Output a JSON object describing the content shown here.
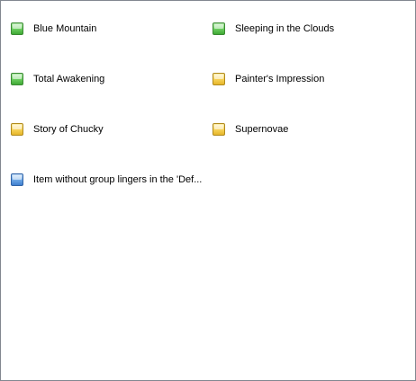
{
  "items": [
    {
      "label": "Blue Mountain",
      "icon": "green-square-icon",
      "color": "green"
    },
    {
      "label": "Sleeping in the Clouds",
      "icon": "green-square-icon",
      "color": "green"
    },
    {
      "label": "Total Awakening",
      "icon": "green-square-icon",
      "color": "green"
    },
    {
      "label": "Painter's Impression",
      "icon": "yellow-square-icon",
      "color": "yellow"
    },
    {
      "label": "Story of Chucky",
      "icon": "yellow-square-icon",
      "color": "yellow"
    },
    {
      "label": "Supernovae",
      "icon": "yellow-square-icon",
      "color": "yellow"
    },
    {
      "label": "Item without group lingers in the 'Def...",
      "icon": "blue-square-icon",
      "color": "blue"
    }
  ],
  "colors": {
    "border": "#828790",
    "green": "#6dcf62",
    "yellow": "#f7d35a",
    "blue": "#6fa8e6"
  }
}
